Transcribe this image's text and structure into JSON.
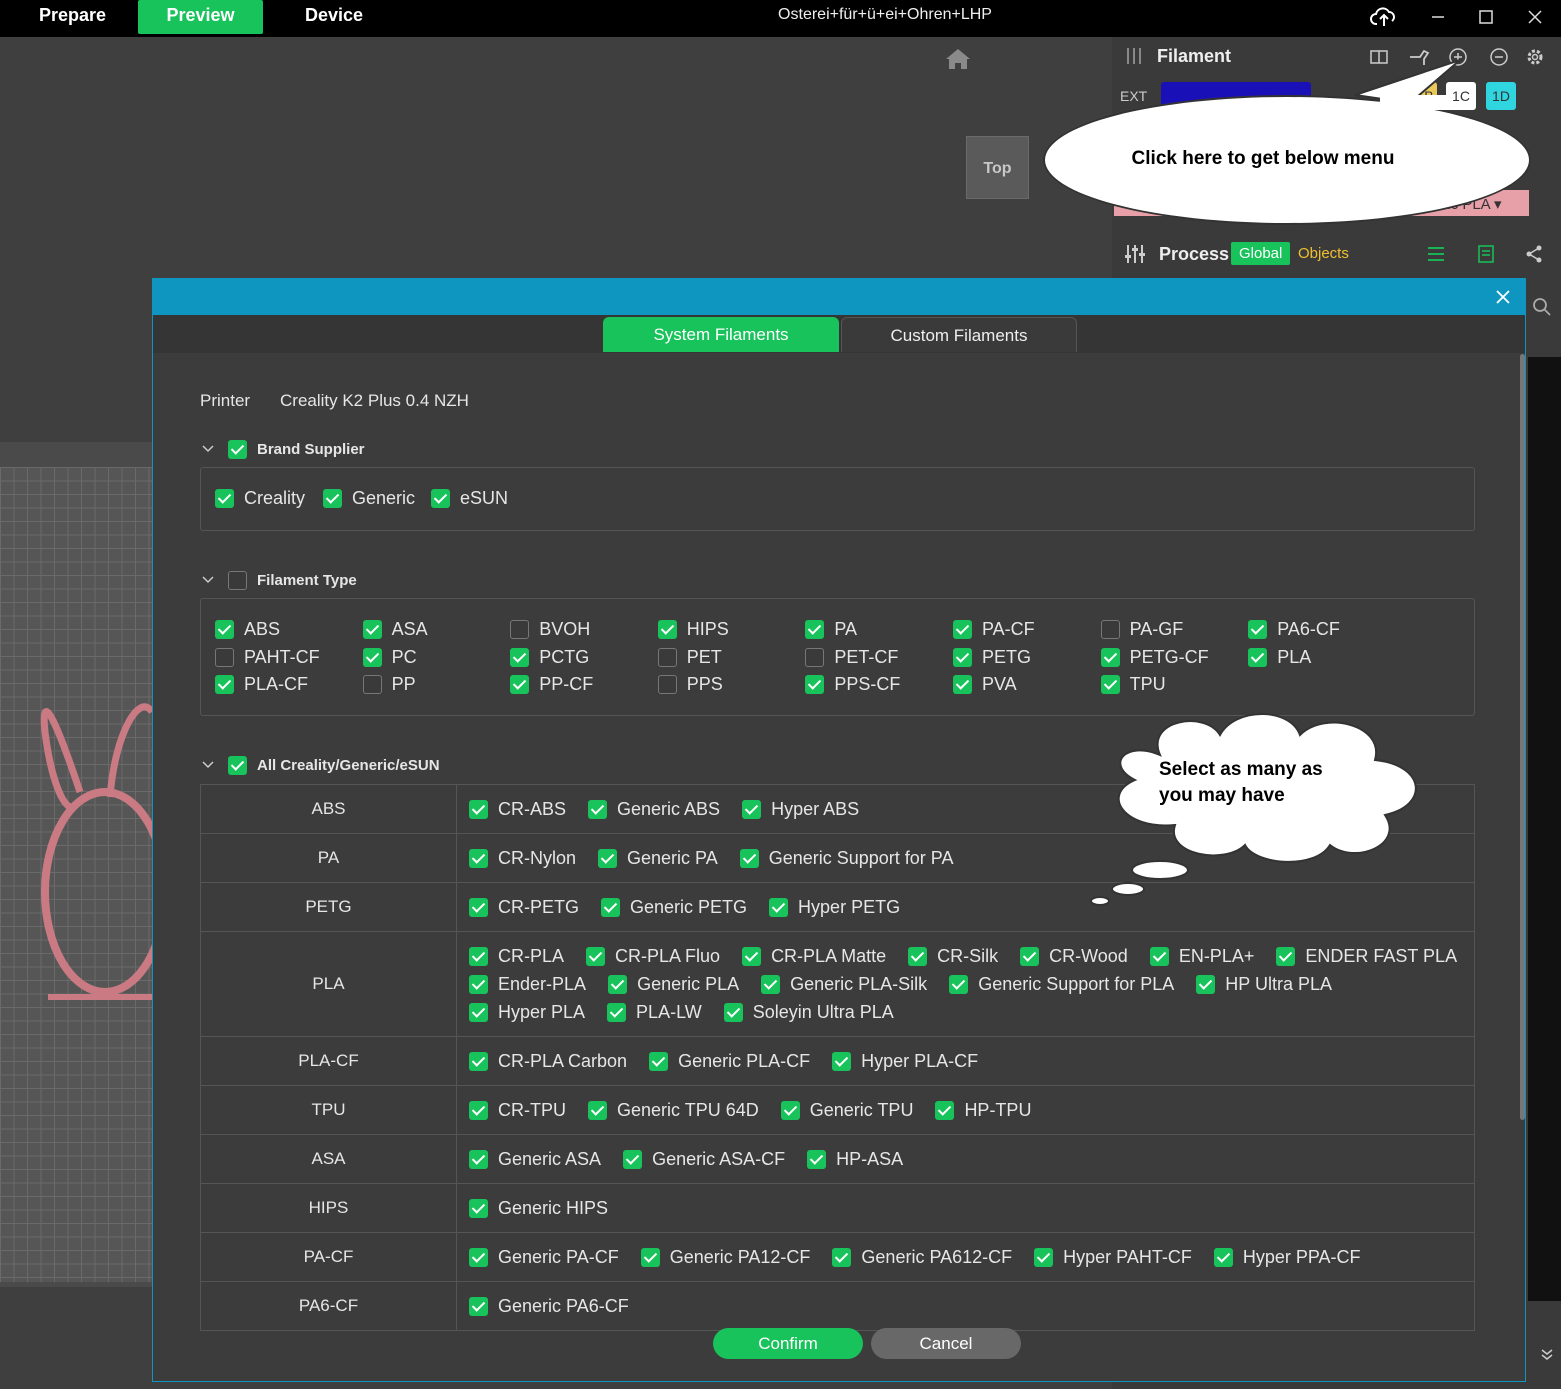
{
  "topbar": {
    "tabs": [
      "Prepare",
      "Preview",
      "Device"
    ],
    "title": "Osterei+für+ü+ei+Ohren+LHP"
  },
  "viewport": {
    "view_label": "Top"
  },
  "filament_panel": {
    "title": "Filament",
    "ext_label": "EXT",
    "slots": [
      "1B",
      "1C",
      "1D"
    ],
    "slot_colors": {
      "1B": "#e8c95a",
      "1C": "#ffffff",
      "1D": "#2fd6e0"
    },
    "ext_color": "#1a10b8",
    "selected_filament": "eric PLA"
  },
  "process_panel": {
    "title": "Process",
    "global_label": "Global",
    "objects_label": "Objects"
  },
  "callout_top": "Click here to get below menu",
  "callout_cloud_line1": "Select as many as",
  "callout_cloud_line2": "you may have",
  "dialog": {
    "tabs": {
      "system": "System Filaments",
      "custom": "Custom Filaments"
    },
    "printer_label": "Printer",
    "printer_value": "Creality K2 Plus 0.4 NZH",
    "brand_section": {
      "title": "Brand Supplier",
      "checked": true,
      "items": [
        {
          "label": "Creality",
          "checked": true
        },
        {
          "label": "Generic",
          "checked": true
        },
        {
          "label": "eSUN",
          "checked": true
        }
      ]
    },
    "type_section": {
      "title": "Filament Type",
      "checked": false,
      "items": [
        {
          "label": "ABS",
          "checked": true
        },
        {
          "label": "ASA",
          "checked": true
        },
        {
          "label": "BVOH",
          "checked": false
        },
        {
          "label": "HIPS",
          "checked": true
        },
        {
          "label": "PA",
          "checked": true
        },
        {
          "label": "PA-CF",
          "checked": true
        },
        {
          "label": "PA-GF",
          "checked": false
        },
        {
          "label": "PA6-CF",
          "checked": true
        },
        {
          "label": "PAHT-CF",
          "checked": false
        },
        {
          "label": "PC",
          "checked": true
        },
        {
          "label": "PCTG",
          "checked": true
        },
        {
          "label": "PET",
          "checked": false
        },
        {
          "label": "PET-CF",
          "checked": false
        },
        {
          "label": "PETG",
          "checked": true
        },
        {
          "label": "PETG-CF",
          "checked": true
        },
        {
          "label": "PLA",
          "checked": true
        },
        {
          "label": "PLA-CF",
          "checked": true
        },
        {
          "label": "PP",
          "checked": false
        },
        {
          "label": "PP-CF",
          "checked": true
        },
        {
          "label": "PPS",
          "checked": false
        },
        {
          "label": "PPS-CF",
          "checked": true
        },
        {
          "label": "PVA",
          "checked": true
        },
        {
          "label": "TPU",
          "checked": true
        }
      ]
    },
    "all_section": {
      "title": "All Creality/Generic/eSUN",
      "checked": true,
      "rows": [
        {
          "category": "ABS",
          "items": [
            "CR-ABS",
            "Generic ABS",
            "Hyper ABS"
          ]
        },
        {
          "category": "PA",
          "items": [
            "CR-Nylon",
            "Generic PA",
            "Generic Support for PA"
          ]
        },
        {
          "category": "PETG",
          "items": [
            "CR-PETG",
            "Generic PETG",
            "Hyper PETG"
          ]
        },
        {
          "category": "PLA",
          "items": [
            "CR-PLA",
            "CR-PLA Fluo",
            "CR-PLA Matte",
            "CR-Silk",
            "CR-Wood",
            "EN-PLA+",
            "ENDER FAST PLA",
            "Ender-PLA",
            "Generic PLA",
            "Generic PLA-Silk",
            "Generic Support for PLA",
            "HP Ultra PLA",
            "Hyper PLA",
            "PLA-LW",
            "Soleyin Ultra PLA"
          ]
        },
        {
          "category": "PLA-CF",
          "items": [
            "CR-PLA Carbon",
            "Generic PLA-CF",
            "Hyper PLA-CF"
          ]
        },
        {
          "category": "TPU",
          "items": [
            "CR-TPU",
            "Generic TPU 64D",
            "Generic TPU",
            "HP-TPU"
          ]
        },
        {
          "category": "ASA",
          "items": [
            "Generic ASA",
            "Generic ASA-CF",
            "HP-ASA"
          ]
        },
        {
          "category": "HIPS",
          "items": [
            "Generic HIPS"
          ]
        },
        {
          "category": "PA-CF",
          "items": [
            "Generic PA-CF",
            "Generic PA12-CF",
            "Generic PA612-CF",
            "Hyper PAHT-CF",
            "Hyper PPA-CF"
          ]
        },
        {
          "category": "PA6-CF",
          "items": [
            "Generic PA6-CF"
          ]
        }
      ]
    },
    "confirm_label": "Confirm",
    "cancel_label": "Cancel"
  },
  "colors": {
    "accent": "#17c35a",
    "header": "#0e96c0",
    "objects": "#f0c030",
    "model": "#c97a82"
  }
}
